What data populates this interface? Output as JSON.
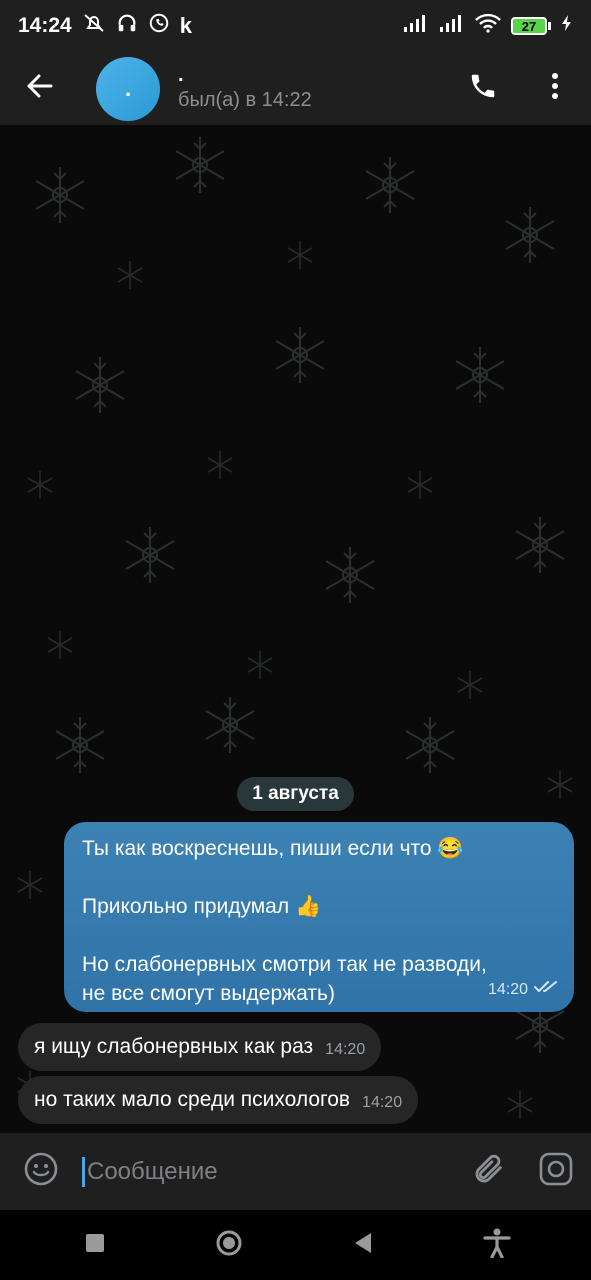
{
  "status_bar": {
    "time": "14:24",
    "battery": "27",
    "app_icon_letter": "k"
  },
  "header": {
    "avatar_text": ".",
    "contact_name": ".",
    "last_seen": "был(а) в 14:22",
    "icons": [
      "back-arrow-icon",
      "phone-icon",
      "more-vertical-icon"
    ]
  },
  "chat": {
    "date_label": "1 августа",
    "outgoing": {
      "lines": [
        "Ты как воскреснешь, пиши если что 😂",
        "Прикольно придумал 👍",
        "Но слабонервных смотри так не разводи,",
        "не все смогут выдержать)"
      ],
      "time": "14:20",
      "status_icon": "double-check-icon"
    },
    "incoming": [
      {
        "text": "я ищу слабонервных как раз",
        "time": "14:20"
      },
      {
        "text": "но таких мало среди психологов",
        "time": "14:20"
      }
    ]
  },
  "composer": {
    "placeholder": "Сообщение",
    "icons": [
      "emoji-icon",
      "attach-icon",
      "camera-icon"
    ]
  },
  "navbar": {
    "icons": [
      "recent-apps-icon",
      "home-icon",
      "back-triangle-icon",
      "accessibility-icon"
    ]
  },
  "colors": {
    "bar_bg": "#1f1f1f",
    "outgoing_bubble": "#3577ab",
    "incoming_bubble": "#262626",
    "accent": "#4fa3e6"
  }
}
